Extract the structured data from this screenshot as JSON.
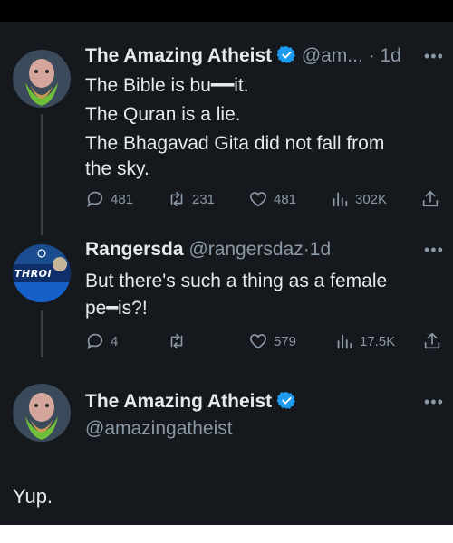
{
  "tweets": [
    {
      "name": "The Amazing Atheist",
      "handle": "@am...",
      "time": "1d",
      "lines": [
        "The Bible is bu━━it.",
        "The Quran is a lie.",
        "The Bhagavad Gita did not fall from",
        "the sky."
      ],
      "stats": {
        "replies": "481",
        "retweets": "231",
        "likes": "481",
        "views": "302K"
      }
    },
    {
      "name": "Rangersda",
      "handle": "@rangersdaz",
      "time": "1d",
      "avatar_text": "THROI",
      "lines": [
        "But there's such a thing as a female",
        "pe━is?!"
      ],
      "stats": {
        "replies": "4",
        "retweets": "",
        "likes": "579",
        "views": "17.5K"
      }
    },
    {
      "name": "The Amazing Atheist",
      "handle": "@amazingatheist",
      "text": "Yup."
    }
  ],
  "separator": "·",
  "more_glyph": "•••",
  "colors": {
    "verified": "#1d9bf0",
    "muted": "#8b98a5",
    "text": "#e7e9ea"
  }
}
